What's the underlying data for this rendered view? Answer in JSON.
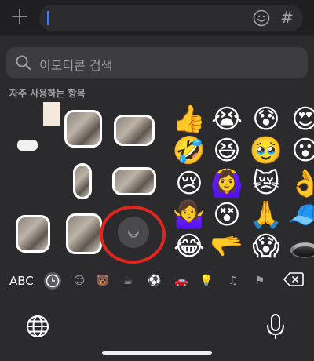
{
  "search": {
    "placeholder": "이모티콘 검색"
  },
  "section_title": "자주 사용하는 항목",
  "keyboard": {
    "abc_label": "ABC",
    "categories": [
      "recent-clock",
      "smileys",
      "animals",
      "food",
      "activity",
      "travel",
      "objects",
      "symbols",
      "flags"
    ]
  },
  "emojis": {
    "col1": [
      "👍",
      "🤣",
      "😢",
      "🤷‍♀️",
      "😂"
    ],
    "col2": [
      "😭",
      "😆",
      "🙆‍♀️",
      "😵",
      "🫳"
    ],
    "col3": [
      "😰",
      "🥹",
      "😿",
      "🙏",
      "😱"
    ],
    "col4": [
      "😍",
      "😮",
      "👌",
      "🧢",
      "🕳️"
    ]
  },
  "colors": {
    "accent_ring": "#e0271f",
    "caret": "#3a7bff",
    "keyboard_bg": "#2b2b2d"
  }
}
